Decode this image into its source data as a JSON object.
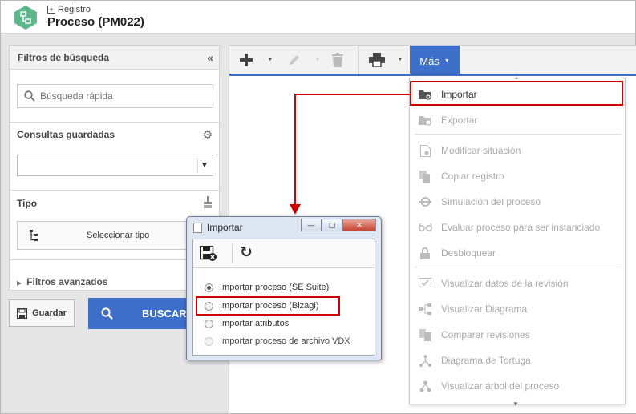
{
  "header": {
    "breadcrumb": "Registro",
    "title": "Proceso (PM022)"
  },
  "left_panel": {
    "title": "Filtros de búsqueda",
    "collapse_glyph": "«",
    "search_placeholder": "Búsqueda rápida",
    "saved_queries_label": "Consultas guardadas",
    "type_label": "Tipo",
    "select_type_label": "Seleccionar tipo",
    "advanced_filters_label": "Filtros avanzados",
    "save_button": "Guardar",
    "search_button": "BUSCAR"
  },
  "toolbar": {
    "more_label": "Más"
  },
  "menu": {
    "items": [
      {
        "label": "Importar",
        "icon": "folder-import-icon",
        "enabled": true
      },
      {
        "label": "Exportar",
        "icon": "folder-export-icon",
        "enabled": false
      },
      {
        "label": "Modificar situación",
        "icon": "document-settings-icon",
        "enabled": false
      },
      {
        "label": "Copiar registro",
        "icon": "copy-icon",
        "enabled": false
      },
      {
        "label": "Simulación del proceso",
        "icon": "simulation-icon",
        "enabled": false
      },
      {
        "label": "Evaluar proceso para ser instanciado",
        "icon": "glasses-icon",
        "enabled": false
      },
      {
        "label": "Desbloquear",
        "icon": "lock-icon",
        "enabled": false
      },
      {
        "label": "Visualizar datos de la revisión",
        "icon": "revision-icon",
        "enabled": false
      },
      {
        "label": "Visualizar Diagrama",
        "icon": "diagram-icon",
        "enabled": false
      },
      {
        "label": "Comparar revisiones",
        "icon": "compare-icon",
        "enabled": false
      },
      {
        "label": "Diagrama de Tortuga",
        "icon": "turtle-diagram-icon",
        "enabled": false
      },
      {
        "label": "Visualizar árbol del proceso",
        "icon": "tree-icon",
        "enabled": false
      }
    ]
  },
  "dialog": {
    "title": "Importar",
    "options": [
      {
        "label": "Importar proceso (SE Suite)",
        "checked": true,
        "enabled": true
      },
      {
        "label": "Importar proceso (Bizagi)",
        "checked": false,
        "enabled": true
      },
      {
        "label": "Importar atributos",
        "checked": false,
        "enabled": true
      },
      {
        "label": "Importar proceso de archivo VDX",
        "checked": false,
        "enabled": false
      }
    ]
  },
  "colors": {
    "accent": "#3d6ec9",
    "highlight": "#d00000",
    "logo": "#5cb88a"
  }
}
